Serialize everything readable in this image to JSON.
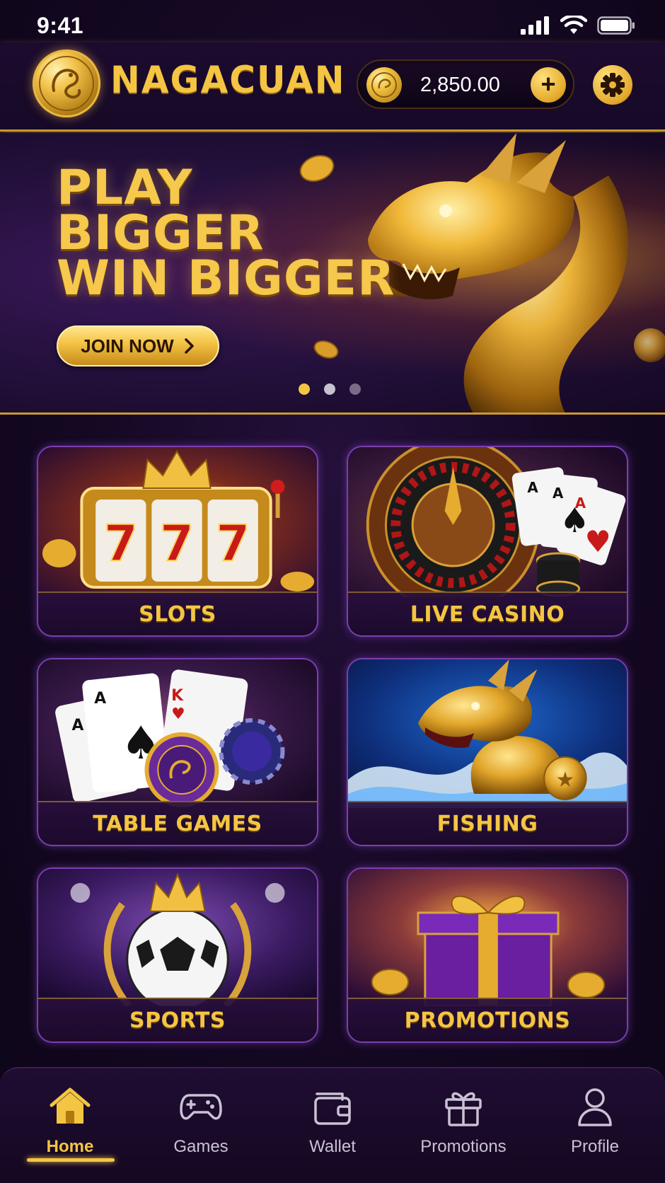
{
  "status_bar": {
    "time": "9:41"
  },
  "header": {
    "brand": "NAGACUAN",
    "balance": "2,850.00",
    "add_label": "+"
  },
  "hero": {
    "line1": "PLAY",
    "line2": "BIGGER",
    "line3": "WIN BIGGER",
    "cta": "JOIN NOW",
    "slide_count": 3,
    "active_slide": 1
  },
  "tiles": [
    {
      "label": "SLOTS"
    },
    {
      "label": "LIVE CASINO"
    },
    {
      "label": "TABLE GAMES"
    },
    {
      "label": "FISHING"
    },
    {
      "label": "SPORTS"
    },
    {
      "label": "PROMOTIONS"
    }
  ],
  "nav": [
    {
      "label": "Home",
      "icon": "home-icon",
      "active": true
    },
    {
      "label": "Games",
      "icon": "gamepad-icon"
    },
    {
      "label": "Wallet",
      "icon": "wallet-icon"
    },
    {
      "label": "Promotions",
      "icon": "gift-icon"
    },
    {
      "label": "Profile",
      "icon": "user-icon"
    }
  ],
  "colors": {
    "gold": "#f4c542",
    "purple_border": "#7a3fb0",
    "background": "#140822"
  }
}
